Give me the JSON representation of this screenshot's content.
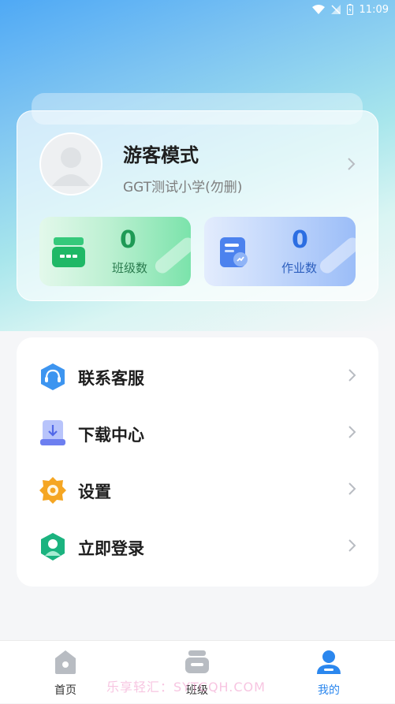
{
  "status_bar": {
    "time": "11:09"
  },
  "profile": {
    "name": "游客模式",
    "school": "GGT测试小学(勿删)",
    "stats": [
      {
        "value": "0",
        "label": "班级数"
      },
      {
        "value": "0",
        "label": "作业数"
      }
    ]
  },
  "menu": [
    {
      "label": "联系客服",
      "icon": "headset-icon"
    },
    {
      "label": "下载中心",
      "icon": "download-icon"
    },
    {
      "label": "设置",
      "icon": "settings-gear-icon"
    },
    {
      "label": "立即登录",
      "icon": "login-user-icon"
    }
  ],
  "tabs": [
    {
      "label": "首页",
      "icon": "home-icon"
    },
    {
      "label": "班级",
      "icon": "class-icon"
    },
    {
      "label": "我的",
      "icon": "profile-icon",
      "active": true
    }
  ],
  "watermark": "乐享轻汇：SYTCQH.COM",
  "colors": {
    "accent": "#2b87ee",
    "class_green": "#1f9a56",
    "homework_blue": "#2c6ee2"
  }
}
